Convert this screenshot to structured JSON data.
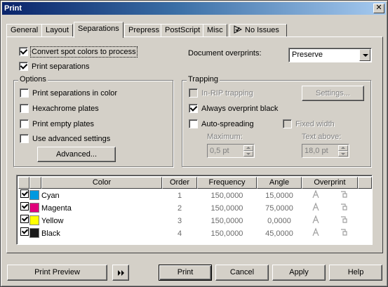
{
  "window": {
    "title": "Print",
    "close_symbol": "✕"
  },
  "tabs": [
    {
      "label": "General",
      "active": false
    },
    {
      "label": "Layout",
      "active": false
    },
    {
      "label": "Separations",
      "active": true
    },
    {
      "label": "Prepress",
      "active": false
    },
    {
      "label": "PostScript",
      "active": false
    },
    {
      "label": "Misc",
      "active": false
    },
    {
      "label": "No Issues",
      "active": false,
      "icon": "no-issues-icon"
    }
  ],
  "separations": {
    "convert_spot": {
      "label": "Convert spot colors to process",
      "checked": true
    },
    "print_separations": {
      "label": "Print separations",
      "checked": true
    },
    "document_overprints": {
      "label": "Document overprints:",
      "value": "Preserve"
    },
    "options": {
      "label": "Options",
      "items": [
        {
          "label": "Print separations in color",
          "checked": false
        },
        {
          "label": "Hexachrome plates",
          "checked": false
        },
        {
          "label": "Print empty plates",
          "checked": false
        },
        {
          "label": "Use advanced settings",
          "checked": false
        }
      ],
      "advanced_button": "Advanced..."
    },
    "trapping": {
      "label": "Trapping",
      "in_rip": {
        "label": "In-RIP trapping",
        "checked": false,
        "disabled": true
      },
      "settings_button": "Settings...",
      "always_overprint_black": {
        "label": "Always overprint black",
        "checked": true
      },
      "auto_spreading": {
        "label": "Auto-spreading",
        "checked": false
      },
      "fixed_width": {
        "label": "Fixed width",
        "checked": false,
        "disabled": true
      },
      "maximum": {
        "label": "Maximum:",
        "value": "0,5 pt"
      },
      "text_above": {
        "label": "Text above:",
        "value": "18,0 pt"
      }
    },
    "table": {
      "headers": [
        "Color",
        "Order",
        "Frequency",
        "Angle",
        "Overprint"
      ],
      "rows": [
        {
          "checked": true,
          "color": "#0099e0",
          "name": "Cyan",
          "order": "1",
          "frequency": "150,0000",
          "angle": "15,0000"
        },
        {
          "checked": true,
          "color": "#e0007a",
          "name": "Magenta",
          "order": "2",
          "frequency": "150,0000",
          "angle": "75,0000"
        },
        {
          "checked": true,
          "color": "#ffff00",
          "name": "Yellow",
          "order": "3",
          "frequency": "150,0000",
          "angle": "0,0000"
        },
        {
          "checked": true,
          "color": "#1a1a1a",
          "name": "Black",
          "order": "4",
          "frequency": "150,0000",
          "angle": "45,0000"
        }
      ]
    }
  },
  "footer": {
    "print_preview": "Print Preview",
    "print": "Print",
    "cancel": "Cancel",
    "apply": "Apply",
    "help": "Help"
  }
}
